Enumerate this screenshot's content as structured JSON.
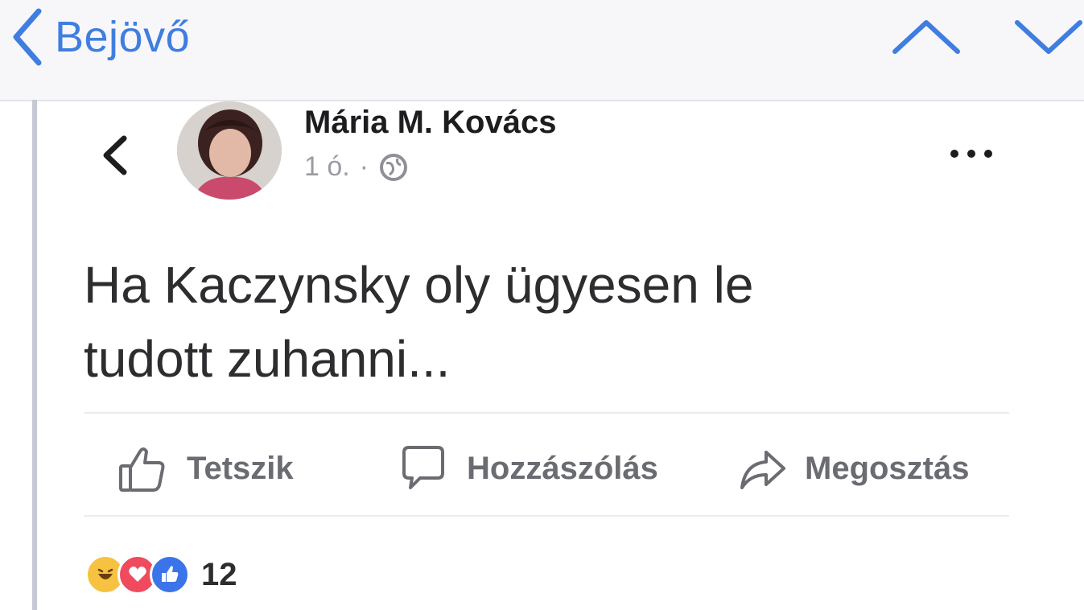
{
  "header": {
    "back_label": "Bejövő",
    "back_icon": "chevron-left-icon",
    "prev_icon": "chevron-up-icon",
    "next_icon": "chevron-down-icon",
    "accent_color": "#3f7ee0"
  },
  "post": {
    "author": "Mária M. Kovács",
    "time": "1 ó.",
    "separator": "·",
    "audience_icon": "globe-icon",
    "text": "Ha Kaczynsky oly ügyesen le\ntudott zuhanni...",
    "more_icon": "more-dots-icon",
    "back_icon": "chevron-left-icon"
  },
  "actions": {
    "like_label": "Tetszik",
    "comment_label": "Hozzászólás",
    "share_label": "Megosztás"
  },
  "reactions": {
    "icons": [
      "haha-reaction-icon",
      "love-reaction-icon",
      "like-reaction-icon"
    ],
    "count": "12"
  }
}
